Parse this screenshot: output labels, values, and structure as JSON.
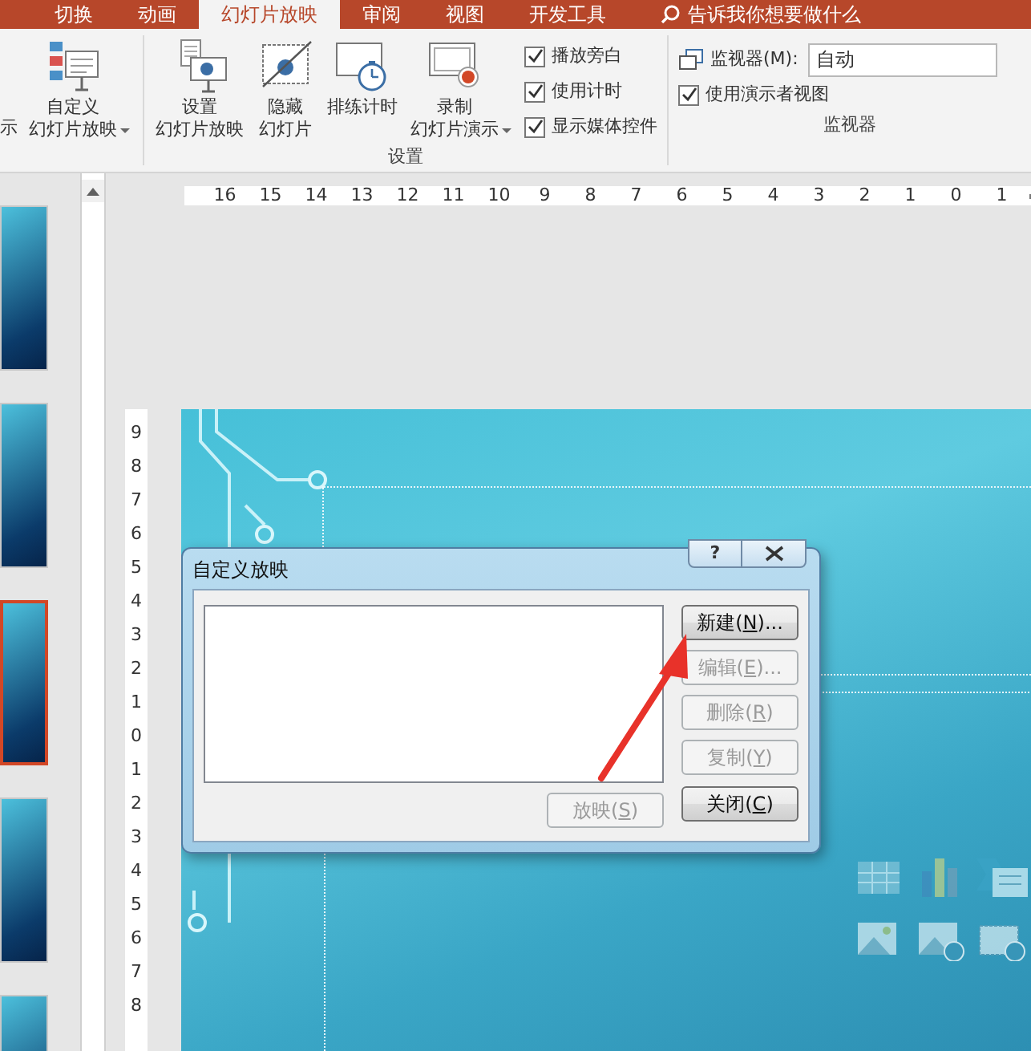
{
  "ribbon_tabs": [
    {
      "label": "切换",
      "selected": false
    },
    {
      "label": "动画",
      "selected": false
    },
    {
      "label": "幻灯片放映",
      "selected": true
    },
    {
      "label": "审阅",
      "selected": false
    },
    {
      "label": "视图",
      "selected": false
    },
    {
      "label": "开发工具",
      "selected": false
    }
  ],
  "tell_me": {
    "placeholder": "告诉我你想要做什么"
  },
  "ribbon": {
    "partial_label": "示",
    "groups": [
      {
        "items": [
          {
            "kind": "custom-show",
            "lines": [
              "自定义",
              "幻灯片放映"
            ],
            "dropdown": true
          }
        ]
      },
      {
        "label": "设置",
        "items": [
          {
            "kind": "setup-show",
            "lines": [
              "设置",
              "幻灯片放映"
            ],
            "dropdown": false
          },
          {
            "kind": "hide-slide",
            "lines": [
              "隐藏",
              "幻灯片"
            ],
            "dropdown": false
          },
          {
            "kind": "rehearse",
            "lines": [
              "排练计时"
            ],
            "dropdown": false
          },
          {
            "kind": "record",
            "lines": [
              "录制",
              "幻灯片演示"
            ],
            "dropdown": true
          },
          {
            "kind": "checks",
            "checks": [
              {
                "label": "播放旁白",
                "checked": true
              },
              {
                "label": "使用计时",
                "checked": true
              },
              {
                "label": "显示媒体控件",
                "checked": true
              }
            ]
          }
        ]
      },
      {
        "label": "监视器",
        "items": [
          {
            "kind": "monitor",
            "label": "监视器(M):",
            "value": "自动"
          },
          {
            "kind": "checks",
            "checks": [
              {
                "label": "使用演示者视图",
                "checked": true
              }
            ]
          }
        ]
      }
    ]
  },
  "slides": [
    {
      "selected": false
    },
    {
      "selected": false
    },
    {
      "selected": true
    },
    {
      "selected": false
    },
    {
      "selected": false
    }
  ],
  "ruler_h": [
    "16",
    "15",
    "14",
    "13",
    "12",
    "11",
    "10",
    "9",
    "8",
    "7",
    "6",
    "5",
    "4",
    "3",
    "2",
    "1",
    "0",
    "1"
  ],
  "ruler_v": [
    "9",
    "8",
    "7",
    "6",
    "5",
    "4",
    "3",
    "2",
    "1",
    "0",
    "1",
    "2",
    "3",
    "4",
    "5",
    "6",
    "7",
    "8"
  ],
  "dialog": {
    "title": "自定义放映",
    "help": "?",
    "buttons": [
      {
        "pre": "新建(",
        "key": "N",
        "post": ")...",
        "disabled": false
      },
      {
        "pre": "编辑(",
        "key": "E",
        "post": ")...",
        "disabled": true
      },
      {
        "pre": "删除(",
        "key": "R",
        "post": ")",
        "disabled": true
      },
      {
        "pre": "复制(",
        "key": "Y",
        "post": ")",
        "disabled": true
      },
      {
        "pre": "关闭(",
        "key": "C",
        "post": ")",
        "disabled": false
      }
    ],
    "show_button": {
      "pre": "放映(",
      "key": "S",
      "post": ")",
      "disabled": true
    }
  }
}
